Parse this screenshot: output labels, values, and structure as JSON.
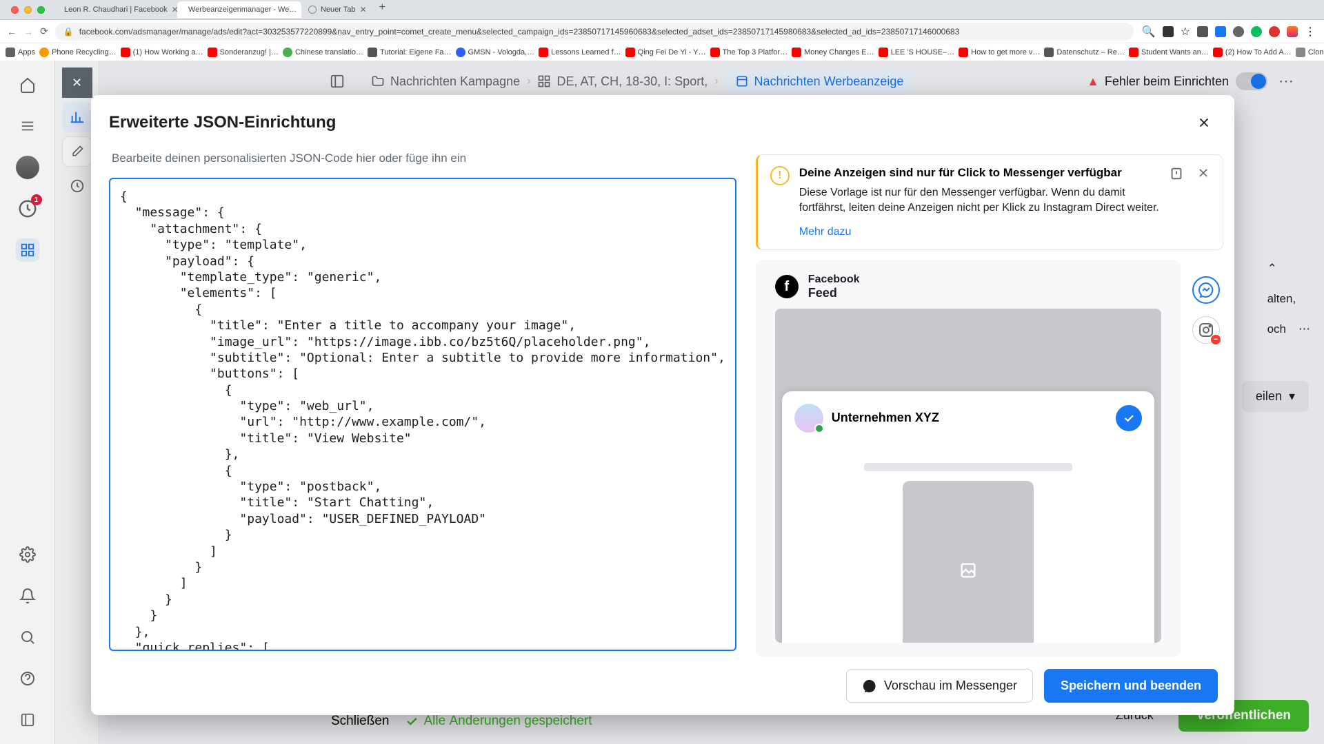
{
  "browser": {
    "tabs": [
      {
        "label": "Leon R. Chaudhari | Facebook"
      },
      {
        "label": "Werbeanzeigenmanager - We…"
      },
      {
        "label": "Neuer Tab"
      }
    ],
    "url": "facebook.com/adsmanager/manage/ads/edit?act=303253577220899&nav_entry_point=comet_create_menu&selected_campaign_ids=23850717145960683&selected_adset_ids=23850717145980683&selected_ad_ids=23850717146000683",
    "bookmarks": [
      "Apps",
      "Phone Recycling…",
      "(1) How Working a…",
      "Sonderanzug! |…",
      "Chinese translatio…",
      "Tutorial: Eigene Fa…",
      "GMSN - Vologda,…",
      "Lessons Learned f…",
      "Qing Fei De Yi - Y…",
      "The Top 3 Platfor…",
      "Money Changes E…",
      "LEE 'S HOUSE–…",
      "How to get more v…",
      "Datenschutz – Re…",
      "Student Wants an…",
      "(2) How To Add A…",
      "Clonezilla - Cooki…"
    ]
  },
  "sidebar": {
    "badge": "1"
  },
  "crumb": {
    "c1": "Nachrichten Kampagne",
    "c2": "DE, AT, CH, 18-30, I: Sport,",
    "c3": "Nachrichten Werbeanzeige",
    "error": "Fehler beim Einrichten"
  },
  "peek": {
    "line1": "alten,",
    "line2": "och",
    "share": "eilen",
    "close": "Schließen",
    "saved": "Alle Änderungen gespeichert",
    "back": "Zurück",
    "publish": "Veröffentlichen"
  },
  "modal": {
    "title": "Erweiterte JSON-Einrichtung",
    "subtitle": "Bearbeite deinen personalisierten JSON-Code hier oder füge ihn ein",
    "json": "{\n  \"message\": {\n    \"attachment\": {\n      \"type\": \"template\",\n      \"payload\": {\n        \"template_type\": \"generic\",\n        \"elements\": [\n          {\n            \"title\": \"Enter a title to accompany your image\",\n            \"image_url\": \"https://image.ibb.co/bz5t6Q/placeholder.png\",\n            \"subtitle\": \"Optional: Enter a subtitle to provide more information\",\n            \"buttons\": [\n              {\n                \"type\": \"web_url\",\n                \"url\": \"http://www.example.com/\",\n                \"title\": \"View Website\"\n              },\n              {\n                \"type\": \"postback\",\n                \"title\": \"Start Chatting\",\n                \"payload\": \"USER_DEFINED_PAYLOAD\"\n              }\n            ]\n          }\n        ]\n      }\n    }\n  },\n  \"quick_replies\": [\n    {\n      \"content_type\": \"text\",",
    "warn": {
      "title": "Deine Anzeigen sind nur für Click to Messenger verfügbar",
      "body": "Diese Vorlage ist nur für den Messenger verfügbar. Wenn du damit fortfährst, leiten deine Anzeigen nicht per Klick zu Instagram Direct weiter.",
      "link": "Mehr dazu"
    },
    "preview": {
      "brand": "Facebook",
      "placement": "Feed",
      "biz": "Unternehmen XYZ"
    },
    "footer": {
      "preview": "Vorschau im Messenger",
      "save": "Speichern und beenden"
    }
  }
}
